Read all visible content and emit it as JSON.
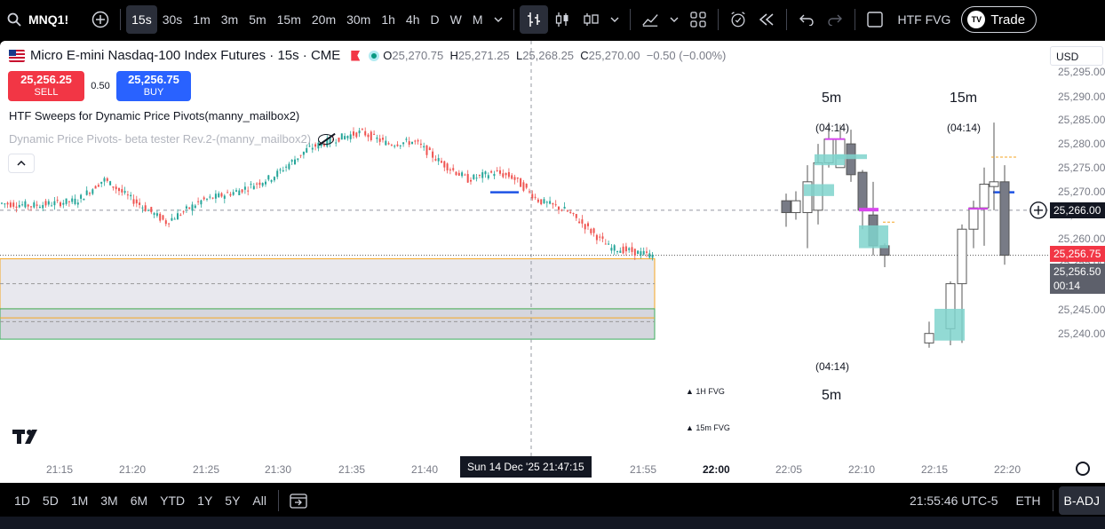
{
  "toolbar": {
    "symbol": "MNQ1!",
    "add_icon": "plus-circle-icon",
    "intervals": [
      "15s",
      "30s",
      "1m",
      "3m",
      "5m",
      "15m",
      "20m",
      "30m",
      "1h",
      "4h",
      "D",
      "W",
      "M"
    ],
    "active_interval": "15s",
    "htf_fvg_label": "HTF FVG",
    "trade_label": "Trade"
  },
  "legend": {
    "title": "Micro E-mini Nasdaq-100 Index Futures · 15s · CME",
    "o_label": "O",
    "o_value": "25,270.75",
    "h_label": "H",
    "h_value": "25,271.25",
    "l_label": "L",
    "l_value": "25,268.25",
    "c_label": "C",
    "c_value": "25,270.00",
    "change": "−0.50 (−0.00%)"
  },
  "trade": {
    "sell_price": "25,256.25",
    "sell_label": "SELL",
    "spread": "0.50",
    "buy_price": "25,256.75",
    "buy_label": "BUY"
  },
  "indicators": {
    "ind1": "HTF Sweeps for Dynamic Price Pivots(manny_mailbox2)",
    "ind2": "Dynamic Price Pivots- beta tester Rev.2-(manny_mailbox2)"
  },
  "annotations": {
    "top_5m": "5m",
    "top_5m_timer": "(04:14)",
    "top_15m": "15m",
    "top_15m_timer": "(04:14)",
    "bottom_timer": "(04:14)",
    "bottom_5m": "5m",
    "fvg_1h": "▲ 1H FVG",
    "fvg_15m": "▲ 15m FVG"
  },
  "price_axis": {
    "currency": "USD",
    "labels": [
      "25,295.00",
      "25,290.00",
      "25,285.00",
      "25,280.00",
      "25,275.00",
      "25,270.00",
      "25,265.00",
      "25,260.00",
      "25,255.00",
      "25,250.00",
      "25,245.00",
      "25,240.00"
    ],
    "crosshair_price": "25,266.00",
    "ask_tag": "25,256.75",
    "last_tag": "25,256.50",
    "countdown": "00:14"
  },
  "time_axis": {
    "labels": [
      "21:15",
      "21:20",
      "21:25",
      "21:30",
      "21:35",
      "21:40",
      "21:55",
      "22:00",
      "22:05",
      "22:10",
      "22:15",
      "22:20"
    ],
    "crosshair_time": "Sun 14 Dec '25   21:47:15"
  },
  "bottom": {
    "ranges": [
      "1D",
      "5D",
      "1M",
      "3M",
      "6M",
      "YTD",
      "1Y",
      "5Y",
      "All"
    ],
    "clock": "21:55:46 UTC-5",
    "session": "ETH",
    "adj": "B-ADJ"
  },
  "colors": {
    "up": "#26a69a",
    "down": "#ef5350",
    "ask": "#f23645",
    "buy": "#2962ff",
    "fvg": "#7fd3cc",
    "pivot": "#1e53e5"
  }
}
